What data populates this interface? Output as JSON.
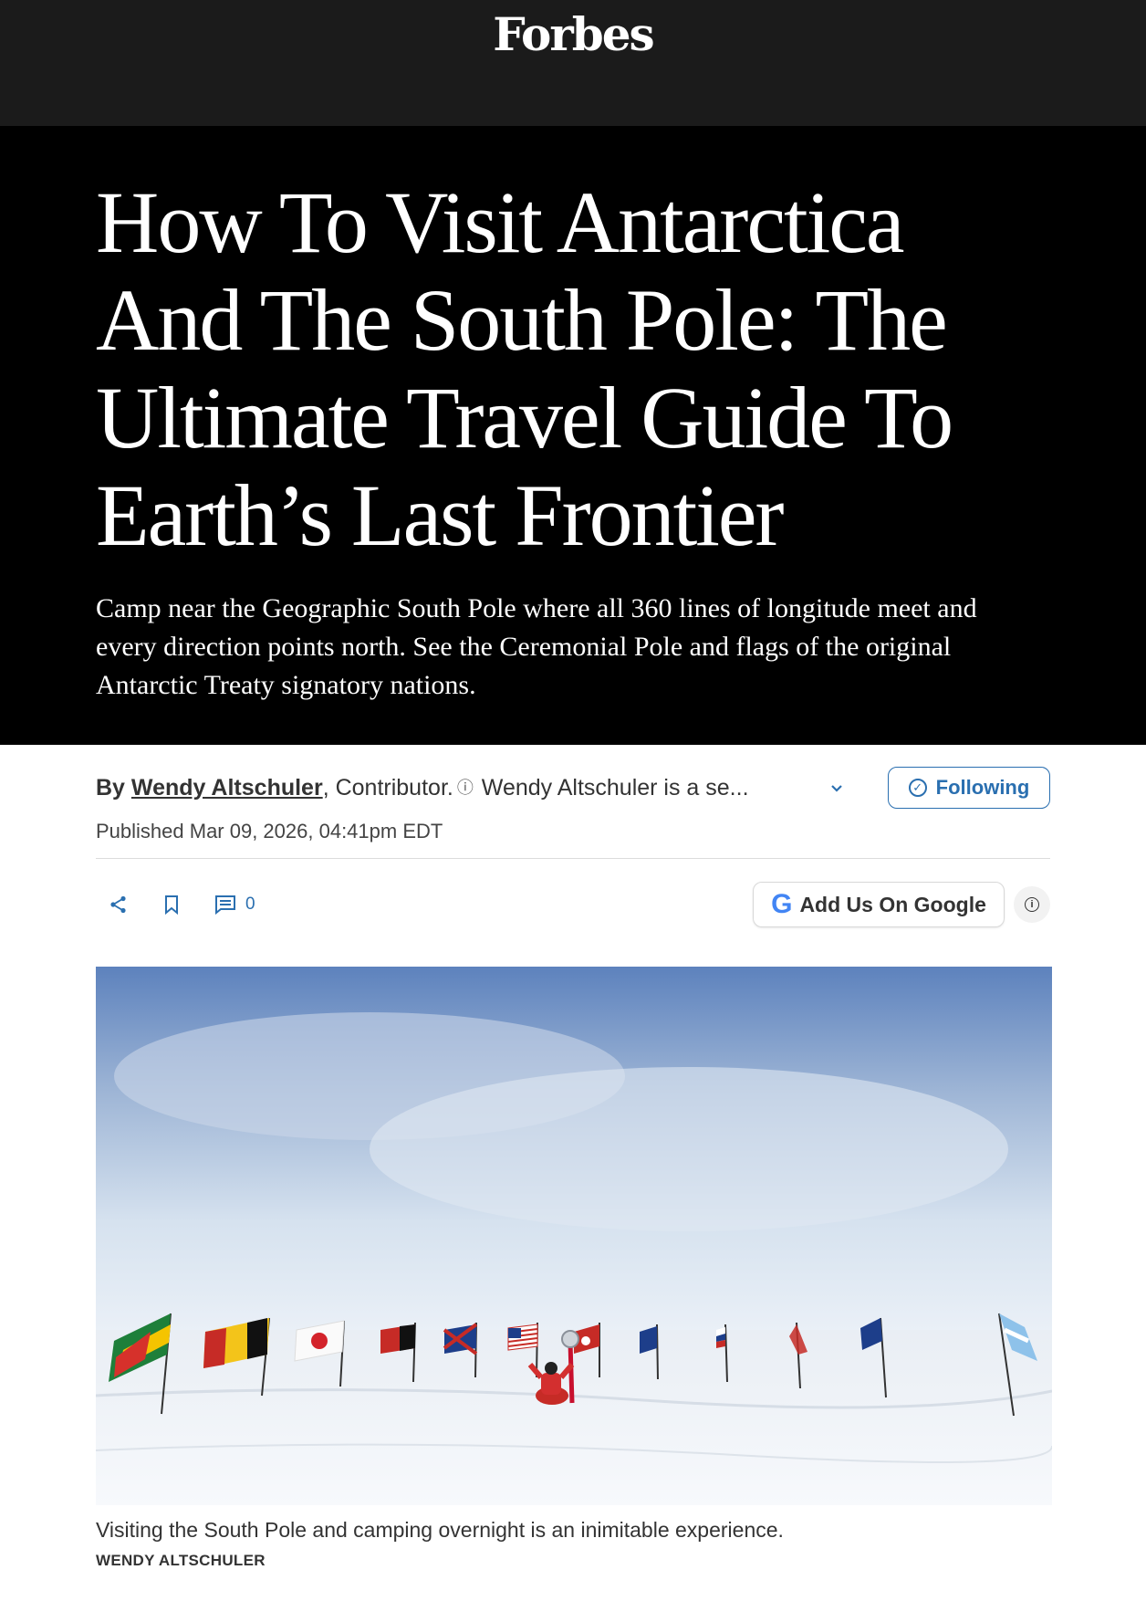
{
  "brand": {
    "logo": "Forbes"
  },
  "article": {
    "headline": "How To Visit Antarctica And The South Pole: The Ultimate Travel Guide To Earth’s Last Frontier",
    "dek": "Camp near the Geographic South Pole where all 360 lines of longitude meet and every direction points north. See the Ceremonial Pole and flags of the original Antarctic Treaty signatory nations."
  },
  "byline": {
    "prefix": "By",
    "author": "Wendy Altschuler",
    "comma": ",",
    "role": "Contributor.",
    "info_icon": "info-circle-icon",
    "bio_truncated": "Wendy Altschuler is a se...",
    "expand_icon": "chevron-down-icon",
    "follow_label": "Following",
    "follow_icon": "check-circle-icon"
  },
  "meta": {
    "published": "Published Mar 09, 2026, 04:41pm EDT"
  },
  "actions": {
    "share_icon": "share-icon",
    "bookmark_icon": "bookmark-icon",
    "comment_icon": "comment-icon",
    "comment_count": "0",
    "google_label": "Add Us On Google",
    "google_icon": "google-g-icon",
    "google_icon_glyph": "G",
    "info_icon": "info-icon",
    "info_glyph": "i"
  },
  "image": {
    "caption": "Visiting the South Pole and camping overnight is an inimitable experience.",
    "credit": "WENDY ALTSCHULER"
  },
  "colors": {
    "header_bg": "#1b1b1b",
    "hero_bg": "#000000",
    "accent": "#2a6fb0"
  }
}
